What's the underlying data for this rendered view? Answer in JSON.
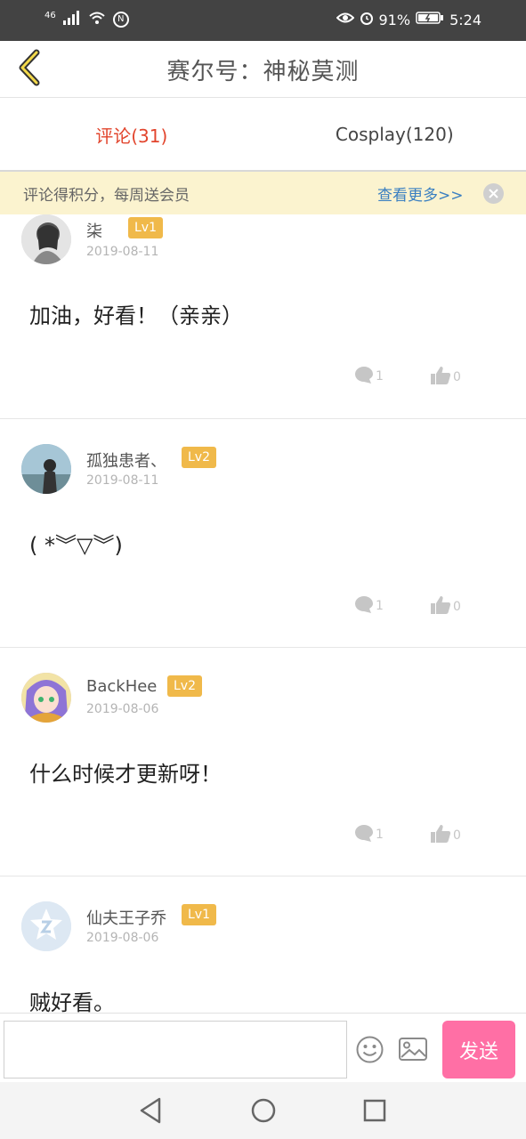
{
  "status_bar": {
    "network": "46",
    "nfc": "N",
    "battery_percent": "91%",
    "time": "5:24"
  },
  "header": {
    "title": "赛尔号：神秘莫测"
  },
  "tabs": [
    {
      "label": "评论(31)",
      "active": true
    },
    {
      "label": "Cosplay(120)",
      "active": false
    }
  ],
  "notice": {
    "text": "评论得积分，每周送会员",
    "more_label": "查看更多>>"
  },
  "comments": [
    {
      "user": "柒",
      "level": "Lv1",
      "date": "2019-08-11",
      "text": "加油，好看！（亲亲）",
      "avatar": "avatar-gray"
    },
    {
      "user": "孤独患者、",
      "level": "Lv2",
      "date": "2019-08-11",
      "text": "( *︾▽︾)",
      "avatar": "avatar-photo"
    },
    {
      "user": "BackHee",
      "level": "Lv2",
      "date": "2019-08-06",
      "text": "什么时候才更新呀！",
      "avatar": "avatar-anime"
    },
    {
      "user": "仙夫王子乔",
      "level": "Lv1",
      "date": "2019-08-06",
      "text": "贼好看。",
      "avatar": "avatar-default"
    }
  ],
  "input": {
    "placeholder": "",
    "send_label": "发送"
  },
  "colors": {
    "status_bar": "#434343",
    "active_tab": "#e2452d",
    "notice_bg": "#fbf3cf",
    "link": "#3a7fc1",
    "level_badge": "#f0b94a",
    "send_button": "#ff6fa5"
  }
}
